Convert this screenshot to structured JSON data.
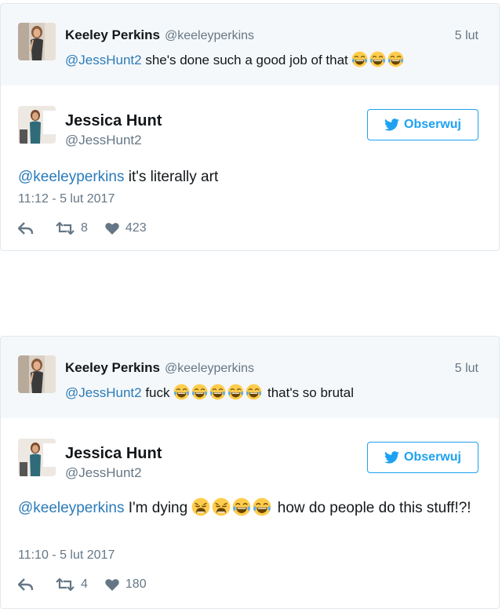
{
  "colors": {
    "link": "#2b7bb9",
    "brand": "#1da1f2",
    "muted": "#657786",
    "parent_bg": "#f5f8fa",
    "border": "#e1e8ed"
  },
  "threads": [
    {
      "parent": {
        "name": "Keeley Perkins",
        "handle": "@keeleyperkins",
        "time": "5 lut",
        "mention": "@JessHunt2",
        "text": "she's done such a good job of that",
        "emojis": [
          "face-with-tears-of-joy",
          "face-with-tears-of-joy",
          "face-with-tears-of-joy"
        ]
      },
      "main": {
        "name": "Jessica Hunt",
        "handle": "@JessHunt2",
        "follow_label": "Obserwuj",
        "mention": "@keeleyperkins",
        "text": "it's literally art",
        "timestamp": "11:12 - 5 lut 2017",
        "retweets": "8",
        "likes": "423"
      }
    },
    {
      "parent": {
        "name": "Keeley Perkins",
        "handle": "@keeleyperkins",
        "time": "5 lut",
        "mention": "@JessHunt2",
        "text_before": "fuck",
        "text_after": "that's so brutal",
        "emojis": [
          "face-with-tears-of-joy",
          "face-with-tears-of-joy",
          "face-with-tears-of-joy",
          "face-with-tears-of-joy",
          "face-with-tears-of-joy"
        ]
      },
      "main": {
        "name": "Jessica Hunt",
        "handle": "@JessHunt2",
        "follow_label": "Obserwuj",
        "mention": "@keeleyperkins",
        "text_before": "I'm dying",
        "text_after": "how do people do this stuff!?!",
        "emojis": [
          "weary-face",
          "weary-face",
          "face-with-tears-of-joy",
          "face-with-tears-of-joy"
        ],
        "timestamp": "11:10 - 5 lut 2017",
        "retweets": "4",
        "likes": "180"
      }
    }
  ]
}
